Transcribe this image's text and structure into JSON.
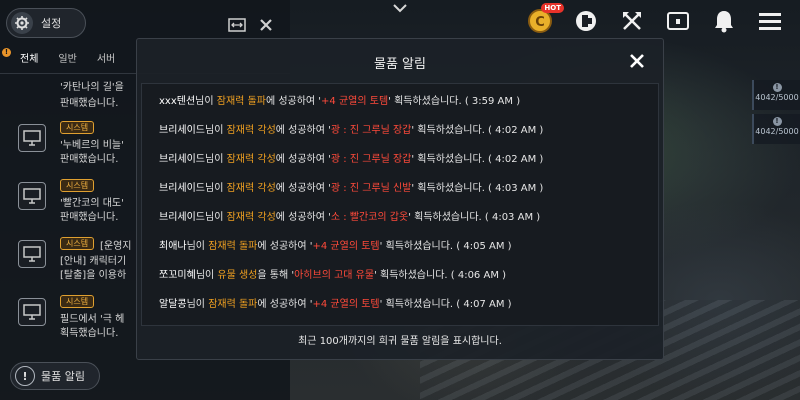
{
  "chat_panel": {
    "settings_label": "설정",
    "tabs": [
      {
        "label": "전체",
        "dot": "!"
      },
      {
        "label": "일반"
      },
      {
        "label": "서버"
      }
    ],
    "messages": [
      {
        "line1": "'카탄나의 길'을",
        "line2": "판매했습니다."
      },
      {
        "badge": "시스템",
        "line1": "'누베르의 비늘'",
        "line2": "판매했습니다."
      },
      {
        "badge": "시스템",
        "line1": "'빨간코의 대도'",
        "line2": "판매했습니다."
      },
      {
        "badge": "시스템",
        "tag": "[운영지",
        "line1": "[안내] 캐릭터기",
        "line2": "[탈출]을 이용하"
      },
      {
        "badge": "시스템",
        "line1": "필드에서 '극 헤",
        "line2": "획득했습니다."
      }
    ],
    "item_alert_label": "물품 알림"
  },
  "hud": {
    "hot_label": "HOT",
    "resources": [
      {
        "icon": "!",
        "value": "4042/5000"
      },
      {
        "icon": "!",
        "value": "4042/5000"
      }
    ]
  },
  "modal": {
    "title": "물품 알림",
    "notices": [
      {
        "player": "xxx텐션",
        "p1": "님이 ",
        "action": "잠재력 돌파",
        "p2": "에 성공하여 '",
        "item": "+4 균열의 토템",
        "p3": "' 획득하셨습니다. ( 3:59 AM )"
      },
      {
        "player": "브리세이드",
        "p1": "님이 ",
        "action": "잠재력 각성",
        "p2": "에 성공하여 '",
        "item": "광 : 진 그루닐 장갑",
        "p3": "' 획득하셨습니다. ( 4:02 AM )"
      },
      {
        "player": "브리세이드",
        "p1": "님이 ",
        "action": "잠재력 각성",
        "p2": "에 성공하여 '",
        "item": "광 : 진 그루닐 장갑",
        "p3": "' 획득하셨습니다. ( 4:02 AM )"
      },
      {
        "player": "브리세이드",
        "p1": "님이 ",
        "action": "잠재력 각성",
        "p2": "에 성공하여 '",
        "item": "광 : 진 그루닐 신발",
        "p3": "' 획득하셨습니다. ( 4:03 AM )"
      },
      {
        "player": "브리세이드",
        "p1": "님이 ",
        "action": "잠재력 각성",
        "p2": "에 성공하여 '",
        "item": "소 : 빨간코의 갑옷",
        "p3": "' 획득하셨습니다. ( 4:03 AM )"
      },
      {
        "player": "최애나",
        "p1": "님이 ",
        "action": "잠재력 돌파",
        "p2": "에 성공하여 '",
        "item": "+4 균열의 토템",
        "p3": "' 획득하셨습니다. ( 4:05 AM )"
      },
      {
        "player": "쪼꼬미혜",
        "p1": "님이 ",
        "action": "유물 생성",
        "p2": "을 통해 '",
        "item": "아히브의 고대 유물",
        "p3": "' 획득하셨습니다. ( 4:06 AM )"
      },
      {
        "player": "알달콩",
        "p1": "님이 ",
        "action": "잠재력 돌파",
        "p2": "에 성공하여 '",
        "item": "+4 균열의 토템",
        "p3": "' 획득하셨습니다. ( 4:07 AM )"
      }
    ],
    "footer": "최근 100개까지의 희귀 물품 알림을 표시합니다."
  }
}
